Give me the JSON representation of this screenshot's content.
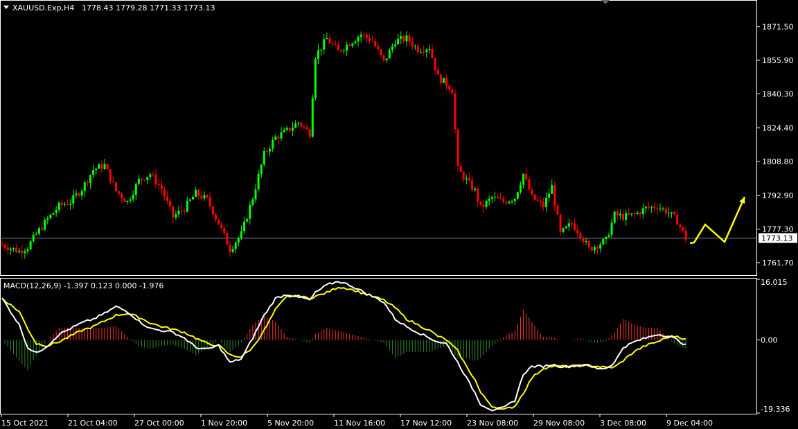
{
  "header": {
    "symbol_timeframe": "XAUUSD.Exp,H4",
    "ohlc": "1778.43 1779.28 1771.33 1773.13"
  },
  "macd_header": "MACD(12,26,9) -1.397 0.123 0.000 -1.976",
  "colors": {
    "background": "#000000",
    "bull_candle": "#00ff00",
    "bear_candle": "#ff0000",
    "signal_line": "#ffff00",
    "macd_line": "#ffffff",
    "hist_positive": "#ff3333",
    "hist_negative": "#2e8b2e",
    "current_price_line": "#7f8fa6"
  },
  "chart_data": [
    {
      "type": "candlestick",
      "name": "price",
      "current_price": 1773.13,
      "price_axis": {
        "ticks": [
          "1871.50",
          "1855.90",
          "1840.30",
          "1824.40",
          "1808.80",
          "1792.90",
          "1777.30",
          "1761.70"
        ],
        "tick_values": [
          1871.5,
          1855.9,
          1840.3,
          1824.4,
          1808.8,
          1792.9,
          1777.3,
          1761.7
        ],
        "current_label": "1773.13",
        "ylim": [
          1756.5,
          1883
        ]
      },
      "time_axis": {
        "labels": [
          "15 Oct 2021",
          "21 Oct 04:00",
          "27 Oct 00:00",
          "1 Nov 20:00",
          "5 Nov 20:00",
          "11 Nov 16:00",
          "17 Nov 12:00",
          "23 Nov 08:00",
          "29 Nov 08:00",
          "3 Dec 08:00",
          "9 Dec 04:00"
        ]
      },
      "keypoints": [
        [
          0,
          1770
        ],
        [
          6,
          1767
        ],
        [
          9,
          1769
        ],
        [
          12,
          1775
        ],
        [
          16,
          1782
        ],
        [
          20,
          1788
        ],
        [
          24,
          1790
        ],
        [
          28,
          1796
        ],
        [
          32,
          1805
        ],
        [
          36,
          1807
        ],
        [
          40,
          1795
        ],
        [
          44,
          1790
        ],
        [
          48,
          1800
        ],
        [
          52,
          1803
        ],
        [
          56,
          1796
        ],
        [
          60,
          1783
        ],
        [
          64,
          1787
        ],
        [
          68,
          1794
        ],
        [
          72,
          1791
        ],
        [
          76,
          1780
        ],
        [
          80,
          1768
        ],
        [
          84,
          1775
        ],
        [
          88,
          1792
        ],
        [
          92,
          1812
        ],
        [
          96,
          1820
        ],
        [
          100,
          1823
        ],
        [
          104,
          1827
        ],
        [
          108,
          1822
        ],
        [
          110,
          1858
        ],
        [
          114,
          1866
        ],
        [
          118,
          1860
        ],
        [
          122,
          1864
        ],
        [
          126,
          1868
        ],
        [
          130,
          1865
        ],
        [
          134,
          1855
        ],
        [
          138,
          1865
        ],
        [
          142,
          1866
        ],
        [
          146,
          1861
        ],
        [
          150,
          1862
        ],
        [
          153,
          1848
        ],
        [
          156,
          1845
        ],
        [
          158,
          1842
        ],
        [
          160,
          1805
        ],
        [
          163,
          1800
        ],
        [
          166,
          1795
        ],
        [
          168,
          1787
        ],
        [
          172,
          1792
        ],
        [
          176,
          1790
        ],
        [
          180,
          1792
        ],
        [
          183,
          1803
        ],
        [
          186,
          1792
        ],
        [
          190,
          1788
        ],
        [
          193,
          1797
        ],
        [
          196,
          1775
        ],
        [
          200,
          1780
        ],
        [
          203,
          1775
        ],
        [
          206,
          1768
        ],
        [
          209,
          1770
        ],
        [
          212,
          1772
        ],
        [
          215,
          1784
        ],
        [
          218,
          1783
        ],
        [
          222,
          1784
        ],
        [
          226,
          1787
        ],
        [
          230,
          1788
        ],
        [
          234,
          1785
        ],
        [
          237,
          1781
        ],
        [
          240,
          1773
        ]
      ],
      "overlay_arrows": [
        [
          996,
          351
        ],
        [
          1002,
          350
        ],
        [
          1018,
          324
        ],
        [
          1046,
          349
        ],
        [
          1075,
          284
        ]
      ]
    },
    {
      "type": "line",
      "name": "MACD(12,26,9)",
      "ylim": [
        -19.336,
        16.015
      ],
      "axis_ticks": [
        "16.015",
        "0.00",
        "-19.336"
      ],
      "tick_values": [
        16.015,
        0.0,
        -19.336
      ],
      "main_line": {
        "name": "MACD",
        "points": [
          [
            0,
            11.0
          ],
          [
            6,
            4.0
          ],
          [
            9,
            -2.0
          ],
          [
            12,
            -3.5
          ],
          [
            16,
            -1.5
          ],
          [
            20,
            1.5
          ],
          [
            24,
            3.0
          ],
          [
            28,
            4.5
          ],
          [
            32,
            5.5
          ],
          [
            36,
            7.0
          ],
          [
            40,
            8.8
          ],
          [
            44,
            7.5
          ],
          [
            48,
            5.0
          ],
          [
            52,
            3.0
          ],
          [
            56,
            2.5
          ],
          [
            60,
            2.0
          ],
          [
            64,
            0.5
          ],
          [
            68,
            -2.0
          ],
          [
            72,
            -2.5
          ],
          [
            76,
            -1.5
          ],
          [
            80,
            -6.0
          ],
          [
            84,
            -5.0
          ],
          [
            88,
            0.5
          ],
          [
            92,
            6.5
          ],
          [
            96,
            11.0
          ],
          [
            100,
            12.0
          ],
          [
            104,
            11.5
          ],
          [
            108,
            10.5
          ],
          [
            110,
            12.5
          ],
          [
            114,
            14.5
          ],
          [
            118,
            15.5
          ],
          [
            122,
            14.5
          ],
          [
            126,
            13.0
          ],
          [
            130,
            11.5
          ],
          [
            134,
            10.0
          ],
          [
            138,
            5.5
          ],
          [
            142,
            3.5
          ],
          [
            146,
            2.0
          ],
          [
            150,
            0.5
          ],
          [
            153,
            -0.5
          ],
          [
            156,
            -1.0
          ],
          [
            160,
            -6.0
          ],
          [
            163,
            -10.0
          ],
          [
            166,
            -14.0
          ],
          [
            168,
            -17.0
          ],
          [
            172,
            -18.5
          ],
          [
            176,
            -18.0
          ],
          [
            180,
            -16.0
          ],
          [
            183,
            -9.0
          ],
          [
            186,
            -7.0
          ],
          [
            190,
            -7.0
          ],
          [
            193,
            -6.5
          ],
          [
            196,
            -7.0
          ],
          [
            200,
            -7.0
          ],
          [
            203,
            -6.5
          ],
          [
            206,
            -7.0
          ],
          [
            209,
            -7.5
          ],
          [
            212,
            -7.5
          ],
          [
            215,
            -6.0
          ],
          [
            218,
            -2.0
          ],
          [
            222,
            -0.5
          ],
          [
            226,
            0.5
          ],
          [
            230,
            1.5
          ],
          [
            234,
            1.0
          ],
          [
            237,
            0.0
          ],
          [
            240,
            -1.4
          ]
        ]
      },
      "signal_line": {
        "name": "Signal",
        "points": [
          [
            0,
            11.0
          ],
          [
            6,
            7.5
          ],
          [
            9,
            3.0
          ],
          [
            12,
            -1.0
          ],
          [
            16,
            -1.5
          ],
          [
            20,
            -0.5
          ],
          [
            24,
            1.0
          ],
          [
            28,
            2.5
          ],
          [
            32,
            3.5
          ],
          [
            36,
            5.0
          ],
          [
            40,
            6.5
          ],
          [
            44,
            7.0
          ],
          [
            48,
            6.0
          ],
          [
            52,
            4.5
          ],
          [
            56,
            3.5
          ],
          [
            60,
            2.8
          ],
          [
            64,
            2.0
          ],
          [
            68,
            0.5
          ],
          [
            72,
            -1.0
          ],
          [
            76,
            -1.5
          ],
          [
            80,
            -4.0
          ],
          [
            84,
            -4.5
          ],
          [
            88,
            -2.0
          ],
          [
            92,
            2.5
          ],
          [
            96,
            8.0
          ],
          [
            100,
            11.5
          ],
          [
            104,
            11.5
          ],
          [
            108,
            11.0
          ],
          [
            110,
            11.5
          ],
          [
            114,
            12.5
          ],
          [
            118,
            14.0
          ],
          [
            122,
            13.5
          ],
          [
            126,
            12.5
          ],
          [
            130,
            11.5
          ],
          [
            134,
            10.5
          ],
          [
            138,
            8.5
          ],
          [
            142,
            5.5
          ],
          [
            146,
            4.0
          ],
          [
            150,
            2.5
          ],
          [
            153,
            1.0
          ],
          [
            156,
            0.0
          ],
          [
            160,
            -3.0
          ],
          [
            163,
            -7.0
          ],
          [
            166,
            -10.5
          ],
          [
            168,
            -14.0
          ],
          [
            172,
            -17.5
          ],
          [
            176,
            -18.5
          ],
          [
            180,
            -17.5
          ],
          [
            183,
            -14.0
          ],
          [
            186,
            -10.0
          ],
          [
            190,
            -7.5
          ],
          [
            193,
            -7.0
          ],
          [
            196,
            -7.0
          ],
          [
            200,
            -7.0
          ],
          [
            203,
            -6.8
          ],
          [
            206,
            -6.7
          ],
          [
            209,
            -7.0
          ],
          [
            212,
            -7.3
          ],
          [
            215,
            -7.2
          ],
          [
            218,
            -5.5
          ],
          [
            222,
            -3.0
          ],
          [
            226,
            -1.5
          ],
          [
            230,
            -0.5
          ],
          [
            234,
            0.8
          ],
          [
            237,
            1.0
          ],
          [
            240,
            0.1
          ]
        ]
      }
    }
  ]
}
